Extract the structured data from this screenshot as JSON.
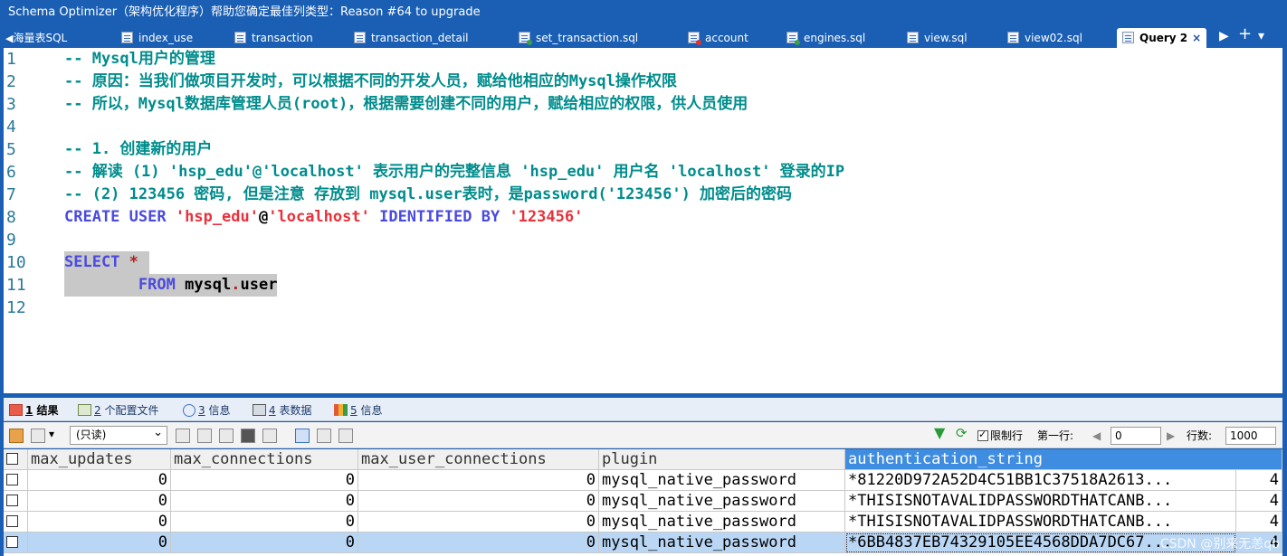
{
  "window": {
    "title": "Schema Optimizer（架构优化程序）帮助您确定最佳列类型：Reason #64 to upgrade"
  },
  "tabs": [
    {
      "label": "海量表SQL",
      "icon": "table-icon"
    },
    {
      "label": "index_use",
      "icon": "query-file-icon"
    },
    {
      "label": "transaction",
      "icon": "query-file-icon"
    },
    {
      "label": "transaction_detail",
      "icon": "query-file-icon"
    },
    {
      "label": "set_transaction.sql",
      "icon": "query-file-icon"
    },
    {
      "label": "account",
      "icon": "table-data-icon"
    },
    {
      "label": "engines.sql",
      "icon": "query-file-icon"
    },
    {
      "label": "view.sql",
      "icon": "query-file-icon"
    },
    {
      "label": "view02.sql",
      "icon": "query-file-icon"
    },
    {
      "label": "Query 2",
      "icon": "query-file-icon",
      "active": true
    }
  ],
  "tab_nav": {
    "prev": "◀",
    "next": "▶",
    "add": "+",
    "menu": "▾"
  },
  "editor": {
    "lines": [
      {
        "n": "1",
        "text": "-- Mysql用户的管理"
      },
      {
        "n": "2",
        "text": "-- 原因：当我们做项目开发时，可以根据不同的开发人员，赋给他相应的Mysql操作权限"
      },
      {
        "n": "3",
        "text": "-- 所以，Mysql数据库管理人员(root)，根据需要创建不同的用户，赋给相应的权限，供人员使用"
      },
      {
        "n": "4",
        "text": ""
      },
      {
        "n": "5",
        "text": "-- 1. 创建新的用户"
      },
      {
        "n": "6",
        "text": "-- 解读 (1) 'hsp_edu'@'localhost' 表示用户的完整信息 'hsp_edu' 用户名 'localhost' 登录的IP"
      },
      {
        "n": "7",
        "text": "-- (2) 123456 密码, 但是注意 存放到 mysql.user表时，是password('123456') 加密后的密码"
      },
      {
        "n": "8",
        "parts": [
          "CREATE",
          " ",
          "USER",
          " ",
          "'hsp_edu'",
          "@",
          "'localhost'",
          " ",
          "IDENTIFIED",
          " ",
          "BY",
          " ",
          "'123456'"
        ]
      },
      {
        "n": "9",
        "text": ""
      },
      {
        "n": "10",
        "parts": [
          "SELECT",
          " ",
          "*"
        ]
      },
      {
        "n": "11",
        "parts": [
          "        ",
          "FROM",
          " ",
          "mysql",
          ".",
          "user"
        ]
      },
      {
        "n": "12",
        "text": ""
      }
    ]
  },
  "result_tabs": [
    {
      "num": "1",
      "label": "结果",
      "icon": "result-grid-icon",
      "active": true
    },
    {
      "num": "2",
      "label": "个配置文件",
      "icon": "profile-icon"
    },
    {
      "num": "3",
      "label": "信息",
      "icon": "info-icon"
    },
    {
      "num": "4",
      "label": "表数据",
      "icon": "table-data-icon"
    },
    {
      "num": "5",
      "label": "信息",
      "icon": "info-history-icon"
    }
  ],
  "toolbar": {
    "mode_select": "(只读)",
    "limit_label": "限制行",
    "first_row_label": "第一行:",
    "first_row_value": "0",
    "rows_label": "行数:",
    "rows_value": "1000"
  },
  "grid": {
    "columns": [
      "max_updates",
      "max_connections",
      "max_user_connections",
      "plugin",
      "authentication_string"
    ],
    "rows": [
      {
        "max_updates": "0",
        "max_connections": "0",
        "max_user_connections": "0",
        "plugin": "mysql_native_password",
        "authentication_string": "*81220D972A52D4C51BB1C37518A2613...",
        "extra": "4"
      },
      {
        "max_updates": "0",
        "max_connections": "0",
        "max_user_connections": "0",
        "plugin": "mysql_native_password",
        "authentication_string": "*THISISNOTAVALIDPASSWORDTHATCANB...",
        "extra": "4"
      },
      {
        "max_updates": "0",
        "max_connections": "0",
        "max_user_connections": "0",
        "plugin": "mysql_native_password",
        "authentication_string": "*THISISNOTAVALIDPASSWORDTHATCANB...",
        "extra": "4"
      },
      {
        "max_updates": "0",
        "max_connections": "0",
        "max_user_connections": "0",
        "plugin": "mysql_native_password",
        "authentication_string": "*6BB4837EB74329105EE4568DDA7DC67...",
        "extra": "4",
        "selected": true
      }
    ]
  },
  "watermark": "CSDN @别来无恙qb",
  "colors": {
    "frame": "#1a5fb4",
    "comment": "#008c8c",
    "keyword": "#4a4ae0",
    "string": "#e8323c"
  }
}
